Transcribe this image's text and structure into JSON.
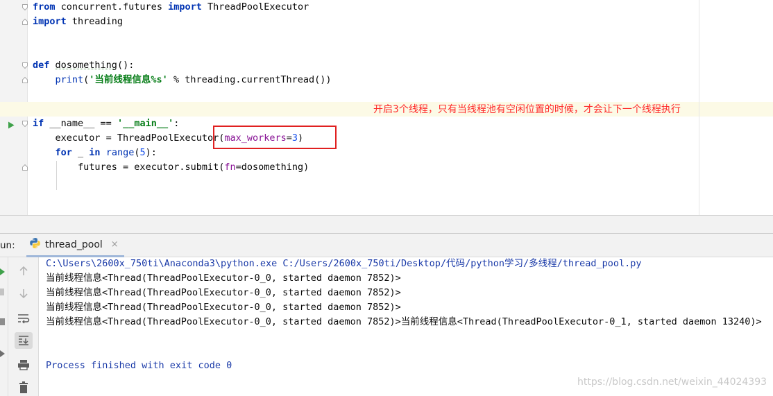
{
  "editor": {
    "code": {
      "l1": {
        "kw1": "from",
        "mod": " concurrent.futures ",
        "kw2": "import",
        "name": " ThreadPoolExecutor"
      },
      "l2": {
        "kw": "import",
        "name": " threading"
      },
      "l3": {
        "kw": "def",
        "space": " ",
        "fn": "dosomething",
        "rest": "():"
      },
      "l4": {
        "indent": "    ",
        "bi": "print",
        "open": "(",
        "str": "'当前线程信息%s'",
        "rest": " % threading.currentThread())"
      },
      "l5": {
        "kw": "if",
        "mid": " __name__ == ",
        "str": "'__main__'",
        "rest": ":"
      },
      "l6": {
        "indent": "    ",
        "pre": "executor = ThreadPoolExecutor(",
        "param": "max_workers",
        "eq": "=",
        "num": "3",
        "rest": ")"
      },
      "l7": {
        "indent": "    ",
        "kw1": "for",
        "mid": " _ ",
        "kw2": "in",
        "sp": " ",
        "bi": "range",
        "open": "(",
        "num": "5",
        "rest": "):"
      },
      "l8": {
        "indent": "        ",
        "pre": "futures = executor.submit(",
        "param": "fn",
        "rest": "=dosomething)"
      }
    },
    "annotation": "开启3个线程，只有当线程池有空闲位置的时候，才会让下一个线程执行"
  },
  "run": {
    "label": "un:",
    "tab_label": "thread_pool",
    "close_glyph": "×",
    "console": [
      "C:\\Users\\2600x_750ti\\Anaconda3\\python.exe C:/Users/2600x_750ti/Desktop/代码/python学习/多线程/thread_pool.py",
      "当前线程信息<Thread(ThreadPoolExecutor-0_0, started daemon 7852)>",
      "当前线程信息<Thread(ThreadPoolExecutor-0_0, started daemon 7852)>",
      "当前线程信息<Thread(ThreadPoolExecutor-0_0, started daemon 7852)>",
      "当前线程信息<Thread(ThreadPoolExecutor-0_0, started daemon 7852)>当前线程信息<Thread(ThreadPoolExecutor-0_1, started daemon 13240)>",
      "Process finished with exit code 0"
    ]
  },
  "watermark": "https://blog.csdn.net/weixin_44024393",
  "colors": {
    "keyword": "#0033b3",
    "string": "#067d17",
    "number": "#1750eb",
    "parameter": "#871094",
    "annotation": "#ff2b2b",
    "highlight_box": "#e02020",
    "console_path": "#1a3aa8"
  },
  "icons": [
    "fold-marker-icon",
    "run-gutter-icon",
    "python-icon",
    "close-icon",
    "up-arrow-icon",
    "down-arrow-icon",
    "soft-wrap-icon",
    "scroll-to-end-icon",
    "print-icon",
    "trash-icon"
  ]
}
